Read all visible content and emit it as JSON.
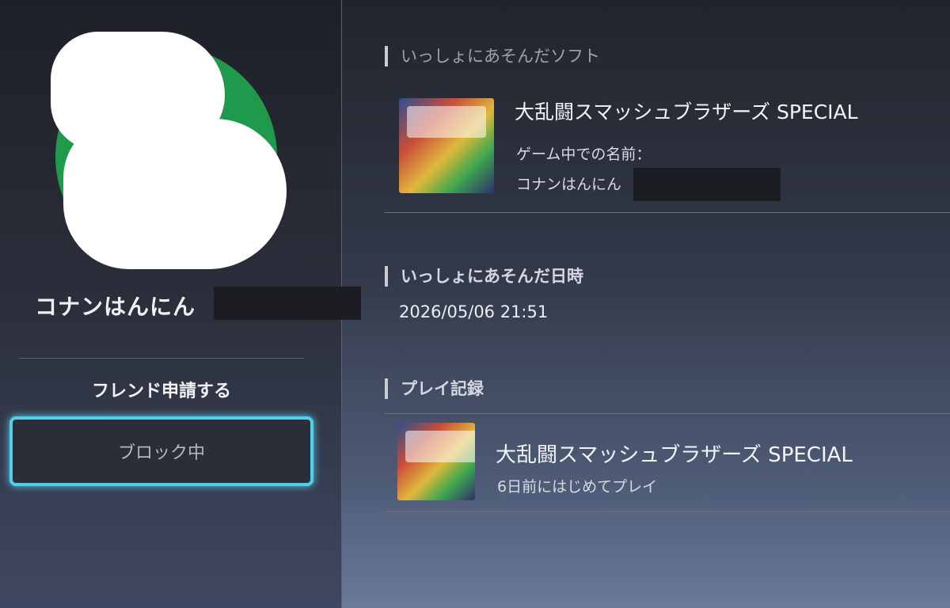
{
  "profile": {
    "name": "コナンはんにん",
    "friend_request_label": "フレンド申請する",
    "block_label": "ブロック中"
  },
  "software_section": {
    "title": "いっしょにあそんだソフト",
    "game_title": "大乱闘スマッシュブラザーズ SPECIAL",
    "ingame_name_label": "ゲーム中での名前：",
    "ingame_name": "コナンはんにん"
  },
  "date_section": {
    "title": "いっしょにあそんだ日時",
    "datetime": "2026/05/06 21:51"
  },
  "play_record_section": {
    "title": "プレイ記録",
    "game_title": "大乱闘スマッシュブラザーズ SPECIAL",
    "first_played": "6日前にはじめてプレイ"
  },
  "colors": {
    "avatar_bg": "#1f9a4c",
    "focus_border": "#4fd0e8"
  }
}
